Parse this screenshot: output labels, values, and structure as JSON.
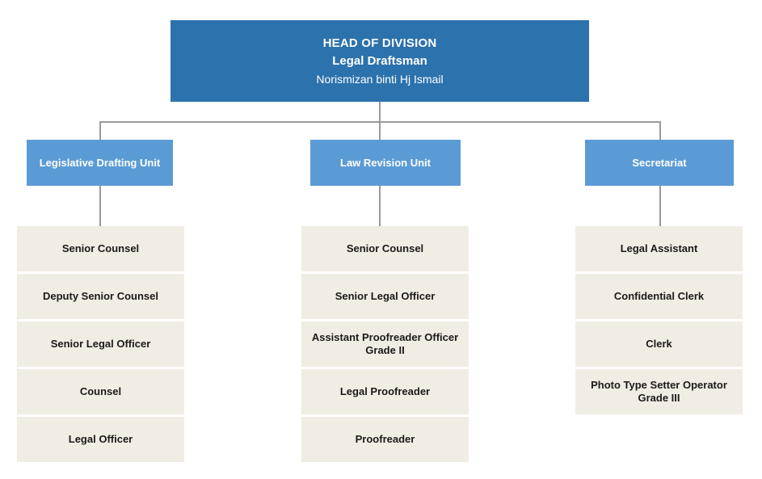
{
  "theme": {
    "head_blue": "#2c72ad",
    "unit_blue": "#5b9bd5",
    "role_beige": "#f0ede4",
    "line_gray": "#9a9a9a",
    "text_light": "#ffffff",
    "text_dark": "#1a1a1a"
  },
  "head": {
    "title": "HEAD OF DIVISION",
    "role": "Legal Draftsman",
    "person": "Norismizan binti Hj Ismail"
  },
  "units": [
    {
      "label": "Legislative Drafting Unit",
      "roles": [
        "Senior Counsel",
        "Deputy Senior Counsel",
        "Senior Legal Officer",
        "Counsel",
        "Legal Officer"
      ]
    },
    {
      "label": "Law Revision Unit",
      "roles": [
        "Senior Counsel",
        "Senior Legal Officer",
        "Assistant Proofreader Officer Grade II",
        "Legal Proofreader",
        "Proofreader"
      ]
    },
    {
      "label": "Secretariat",
      "roles": [
        "Legal Assistant",
        "Confidential Clerk",
        "Clerk",
        "Photo Type Setter Operator Grade III"
      ]
    }
  ]
}
